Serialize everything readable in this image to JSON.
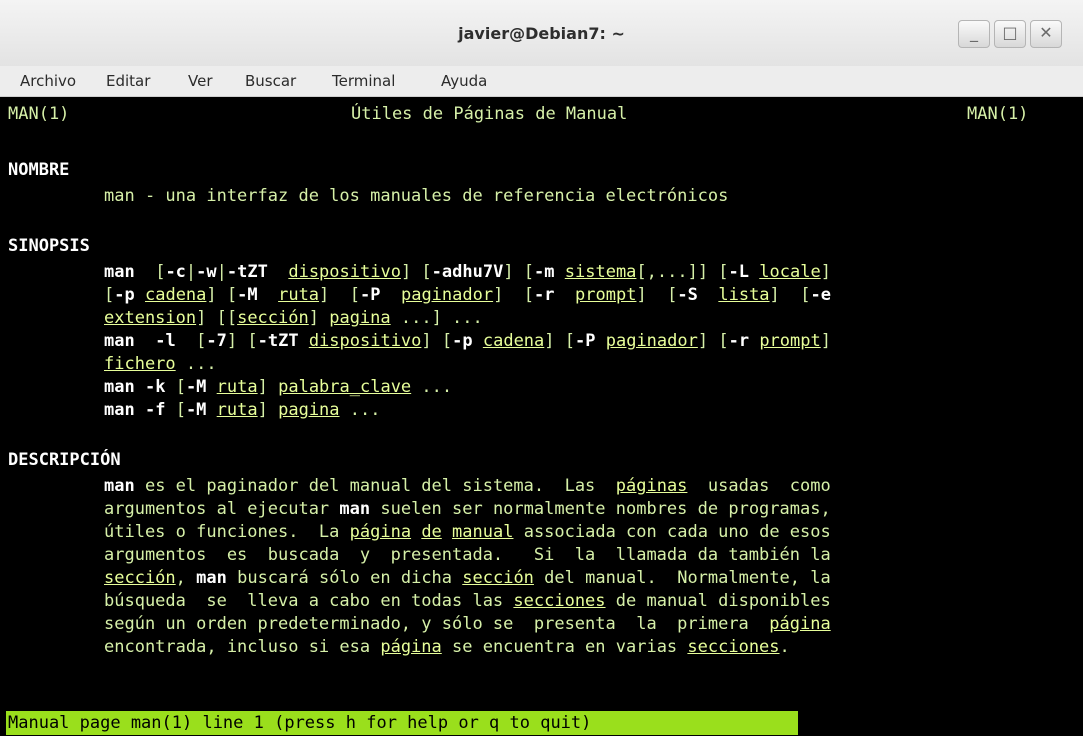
{
  "window": {
    "title": "javier@Debian7: ~",
    "controls": {
      "minimize": "_",
      "maximize": "□",
      "close": "✕"
    }
  },
  "menubar": [
    "Archivo",
    "Editar",
    "Ver",
    "Buscar",
    "Terminal",
    "Ayuda"
  ],
  "man": {
    "header_left": "MAN(1)",
    "header_center": "Útiles de Páginas de Manual",
    "header_right": "MAN(1)",
    "nombre_heading": "NOMBRE",
    "nombre_text": "man - una interfaz de los manuales de referencia electrónicos",
    "sinopsis_heading": "SINOPSIS",
    "descripcion_heading": "DESCRIPCIÓN"
  },
  "status": "Manual page man(1) line 1 (press h for help or q to quit)",
  "colors": {
    "terminal_bg": "#000000",
    "terminal_fg": "#d6f0a8",
    "status_bg": "#9adf1c"
  }
}
